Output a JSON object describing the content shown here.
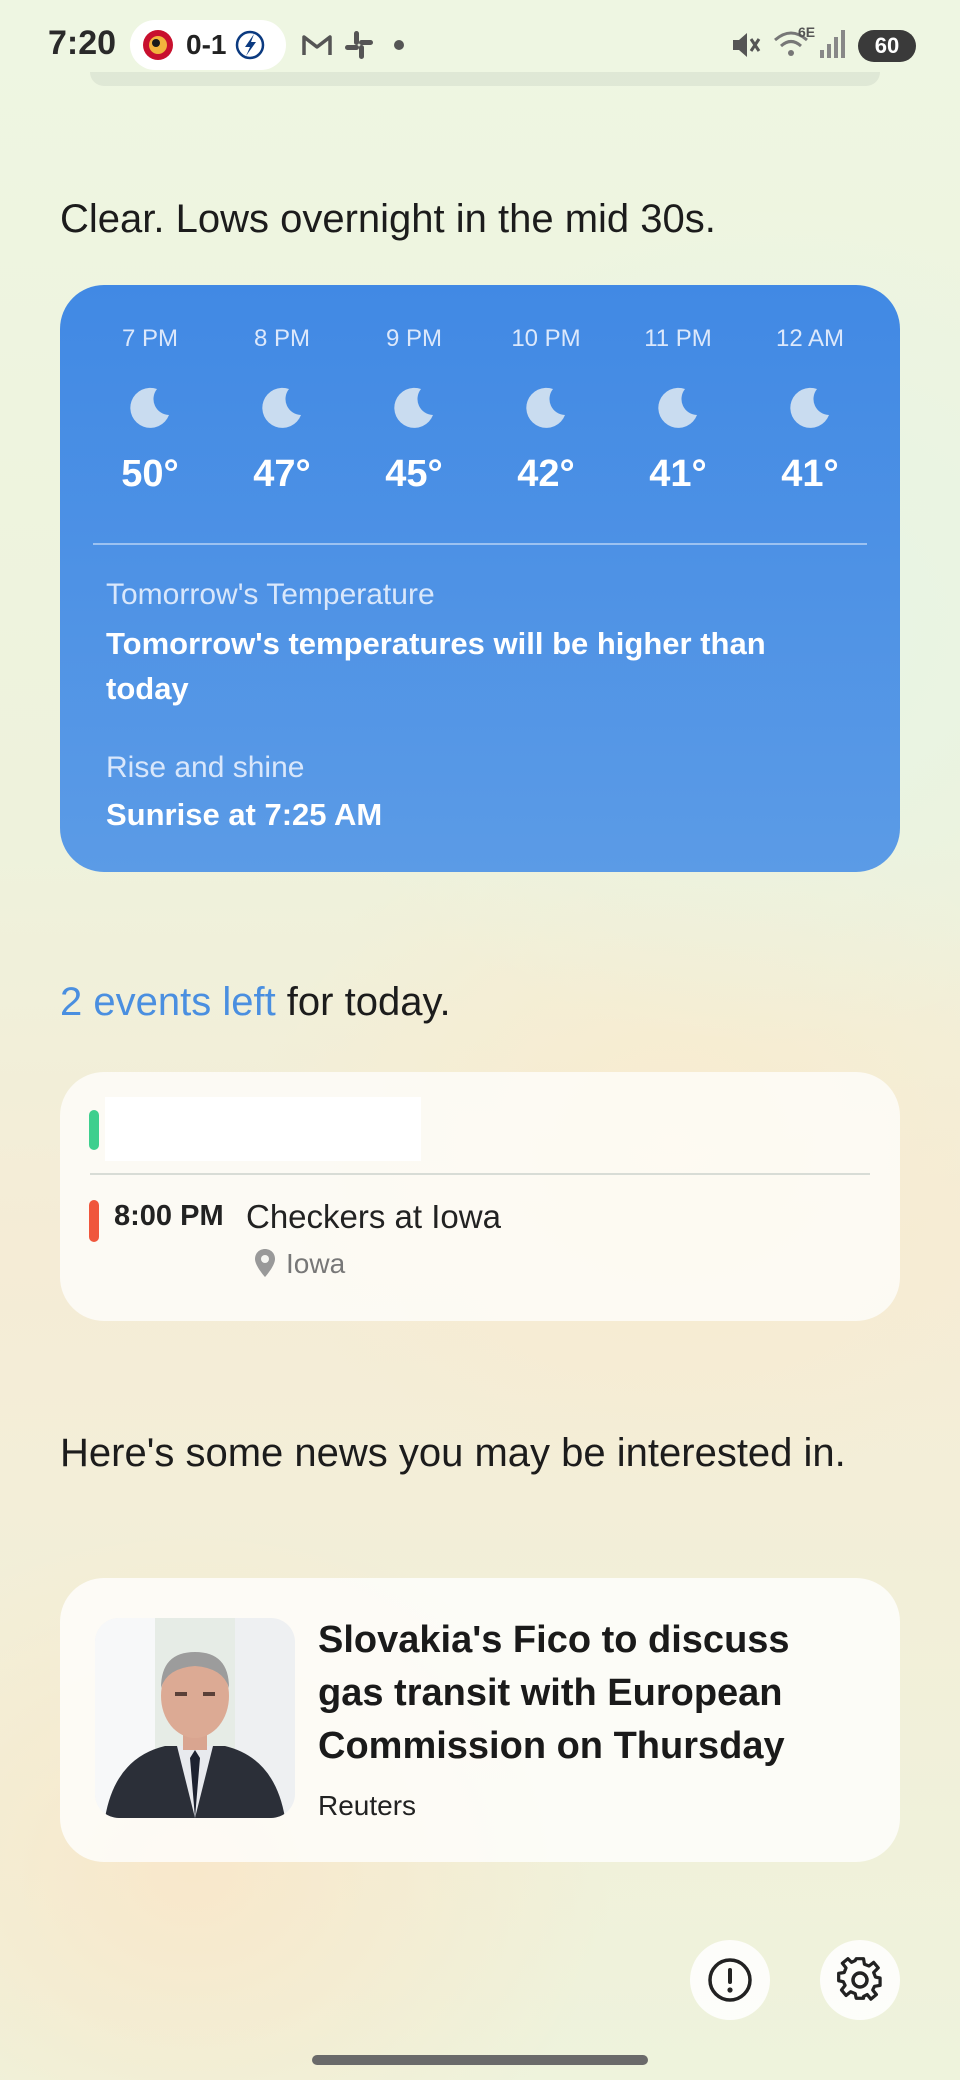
{
  "status_bar": {
    "time": "7:20",
    "score": "0-1",
    "battery": "60",
    "network": "6E"
  },
  "weather": {
    "summary": "Clear. Lows overnight in the mid 30s.",
    "hourly": [
      {
        "time": "7 PM",
        "temp": "50°",
        "icon": "moon-icon"
      },
      {
        "time": "8 PM",
        "temp": "47°",
        "icon": "moon-icon"
      },
      {
        "time": "9 PM",
        "temp": "45°",
        "icon": "moon-icon"
      },
      {
        "time": "10 PM",
        "temp": "42°",
        "icon": "moon-icon"
      },
      {
        "time": "11 PM",
        "temp": "41°",
        "icon": "moon-icon"
      },
      {
        "time": "12 AM",
        "temp": "41°",
        "icon": "moon-icon"
      }
    ],
    "tomorrow_label": "Tomorrow's Temperature",
    "tomorrow_value": "Tomorrow's temperatures will be higher than today",
    "sunrise_label": "Rise and shine",
    "sunrise_value": "Sunrise at 7:25 AM",
    "card_color": "#4a8fe4"
  },
  "events": {
    "count_text": "2 events left",
    "suffix_text": " for today.",
    "items": [
      {
        "time": "",
        "title": "",
        "location": "",
        "color": "#3ecf8e"
      },
      {
        "time": "8:00 PM",
        "title": "Checkers at Iowa",
        "location": "Iowa",
        "color": "#f0563c"
      }
    ]
  },
  "news": {
    "intro": "Here's some news you may be interested in.",
    "article": {
      "title": "Slovakia's Fico to discuss gas transit with European Commission on Thursday",
      "source": "Reuters"
    }
  },
  "actions": {
    "feedback_icon": "alert-circle-icon",
    "settings_icon": "gear-icon"
  }
}
